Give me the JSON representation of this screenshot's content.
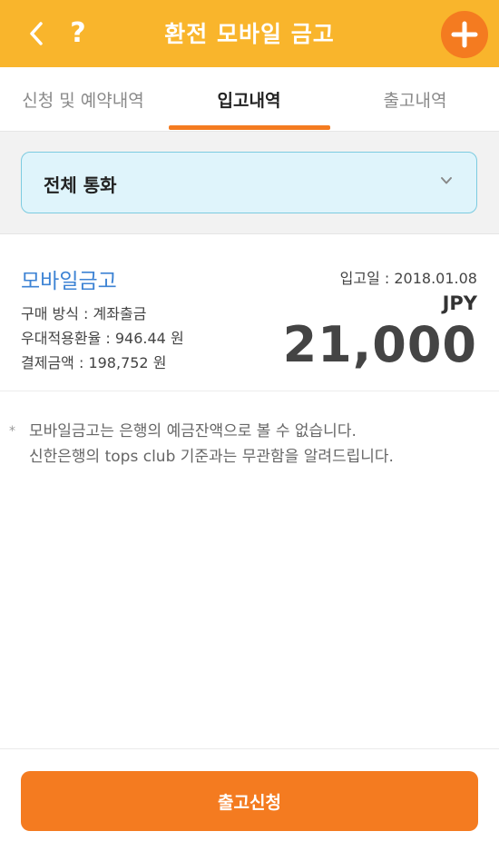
{
  "header": {
    "title": "환전 모바일 금고",
    "help_label": "?",
    "colors": {
      "background": "#f9b52c",
      "accent": "#f47b20"
    }
  },
  "tabs": [
    {
      "label": "신청 및 예약내역",
      "active": false
    },
    {
      "label": "입고내역",
      "active": true
    },
    {
      "label": "출고내역",
      "active": false
    }
  ],
  "filter": {
    "selected": "전체 통화"
  },
  "record": {
    "title": "모바일금고",
    "method": "구매 방식 : 계좌출금",
    "rate": "우대적용환율 : 946.44 원",
    "payment": "결제금액 : 198,752 원",
    "date": "입고일 : 2018.01.08",
    "currency": "JPY",
    "amount": "21,000"
  },
  "notes": {
    "bullet": "*",
    "line1": "모바일금고는 은행의 예금잔액으로 볼 수 없습니다.",
    "line2": "신한은행의 tops club 기준과는 무관함을 알려드립니다."
  },
  "footer": {
    "button_label": "출고신청"
  }
}
